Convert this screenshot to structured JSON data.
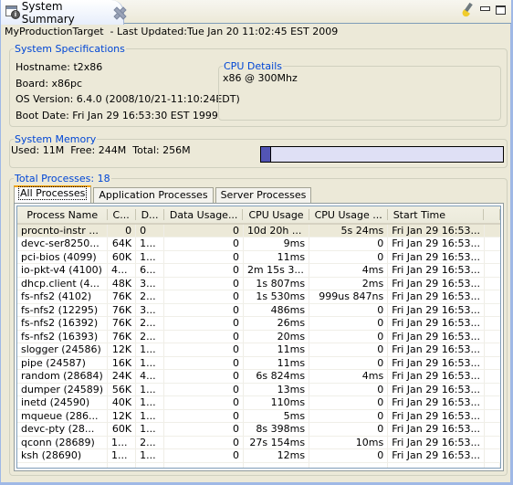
{
  "view_tab": {
    "title": "System Summary",
    "icon": "system-info-icon"
  },
  "toolbar": {
    "clear_icon": "brush-icon",
    "minimize_icon": "minimize-icon",
    "maximize_icon": "maximize-icon"
  },
  "target_line": "MyProductionTarget  - Last Updated:Tue Jan 20 11:02:45 EST 2009",
  "system_specs": {
    "legend": "System Specifications",
    "hostname": "Hostname: t2x86",
    "board": "Board: x86pc",
    "os_version": "OS Version: 6.4.0 (2008/10/21-11:10:24EDT)",
    "boot_date": "Boot Date: Fri Jan 29 16:53:30 EST 1999"
  },
  "cpu_details": {
    "legend": "CPU Details",
    "value": "x86 @ 300Mhz"
  },
  "system_memory": {
    "legend": "System Memory",
    "summary": "Used: 11M  Free: 244M  Total: 256M",
    "used_fraction": 0.043
  },
  "processes": {
    "legend": "Total Processes: 18",
    "tabs": [
      {
        "label": "All Processes",
        "active": true
      },
      {
        "label": "Application Processes",
        "active": false
      },
      {
        "label": "Server Processes",
        "active": false
      }
    ],
    "columns": [
      "Process Name",
      "C...",
      "D...",
      "Data Usage...",
      "CPU Usage",
      "CPU Usage ...",
      "Start Time"
    ],
    "rows": [
      [
        "procnto-instr ...",
        "0",
        "0",
        "0",
        "10d 20h ...",
        "5s 24ms",
        "Fri Jan 29 16:53..."
      ],
      [
        "devc-ser8250...",
        "64K",
        "1...",
        "0",
        "9ms",
        "0",
        "Fri Jan 29 16:53..."
      ],
      [
        "pci-bios (4099)",
        "60K",
        "1...",
        "0",
        "11ms",
        "0",
        "Fri Jan 29 16:53..."
      ],
      [
        "io-pkt-v4 (4100)",
        "4...",
        "6...",
        "0",
        "2m 15s 3...",
        "4ms",
        "Fri Jan 29 16:53..."
      ],
      [
        "dhcp.client (4...",
        "48K",
        "3...",
        "0",
        "1s 807ms",
        "2ms",
        "Fri Jan 29 16:53..."
      ],
      [
        "fs-nfs2 (4102)",
        "76K",
        "2...",
        "0",
        "1s 530ms",
        "999us 847ns",
        "Fri Jan 29 16:53..."
      ],
      [
        "fs-nfs2 (12295)",
        "76K",
        "3...",
        "0",
        "486ms",
        "0",
        "Fri Jan 29 16:53..."
      ],
      [
        "fs-nfs2 (16392)",
        "76K",
        "2...",
        "0",
        "26ms",
        "0",
        "Fri Jan 29 16:53..."
      ],
      [
        "fs-nfs2 (16393)",
        "76K",
        "2...",
        "0",
        "20ms",
        "0",
        "Fri Jan 29 16:53..."
      ],
      [
        "slogger (24586)",
        "12K",
        "1...",
        "0",
        "11ms",
        "0",
        "Fri Jan 29 16:53..."
      ],
      [
        "pipe (24587)",
        "16K",
        "1...",
        "0",
        "11ms",
        "0",
        "Fri Jan 29 16:53..."
      ],
      [
        "random (28684)",
        "24K",
        "4...",
        "0",
        "6s 824ms",
        "4ms",
        "Fri Jan 29 16:53..."
      ],
      [
        "dumper (24589)",
        "56K",
        "1...",
        "0",
        "13ms",
        "0",
        "Fri Jan 29 16:53..."
      ],
      [
        "inetd (24590)",
        "40K",
        "1...",
        "0",
        "110ms",
        "0",
        "Fri Jan 29 16:53..."
      ],
      [
        "mqueue (286...",
        "12K",
        "1...",
        "0",
        "5ms",
        "0",
        "Fri Jan 29 16:53..."
      ],
      [
        "devc-pty (28...",
        "60K",
        "1...",
        "0",
        "8s 398ms",
        "0",
        "Fri Jan 29 16:53..."
      ],
      [
        "qconn (28689)",
        "1...",
        "2...",
        "0",
        "27s 154ms",
        "10ms",
        "Fri Jan 29 16:53..."
      ],
      [
        "ksh (28690)",
        "1...",
        "1...",
        "0",
        "12ms",
        "0",
        "Fri Jan 29 16:53..."
      ]
    ],
    "selected_row": 0
  }
}
